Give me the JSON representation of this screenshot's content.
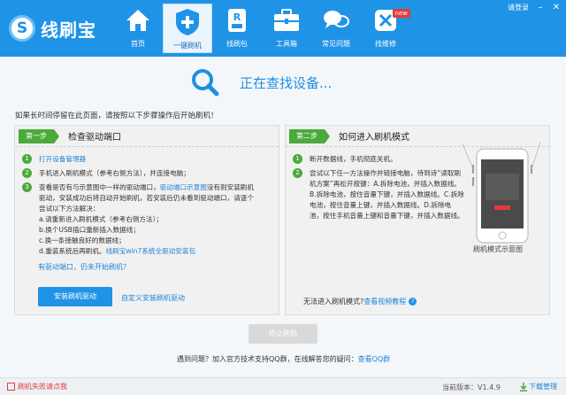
{
  "app": {
    "name": "线刷宝",
    "logo_glyph": "S"
  },
  "nav": [
    {
      "label": "首页",
      "icon": "home-icon"
    },
    {
      "label": "一键刷机",
      "icon": "shield-plus-icon",
      "active": true
    },
    {
      "label": "线刷包",
      "icon": "package-icon"
    },
    {
      "label": "工具箱",
      "icon": "toolbox-icon"
    },
    {
      "label": "常见问题",
      "icon": "chat-icon"
    },
    {
      "label": "找维修",
      "icon": "repair-icon",
      "badge": "new"
    }
  ],
  "topright": {
    "login": "请登录",
    "minimize": "–",
    "close": "✕"
  },
  "status": {
    "text": "正在查找设备..."
  },
  "hint": "如果长时间停留在此页面，请按照以下步骤操作后开始刷机！",
  "step1": {
    "tag": "第一步",
    "title": "检查驱动端口",
    "items": [
      {
        "num": "1",
        "text": "打开设备管理器"
      },
      {
        "num": "2",
        "text": "手机进入刷机模式（参考右侧方法），并连接电脑；"
      },
      {
        "num": "3",
        "text_a": "查看是否有与示意图中一样的驱动端口，",
        "link": "驱动端口示意图",
        "text_b": "没有则安装刷机驱动，安装成功后将自动开始刷机，若安装后仍未看到驱动端口，请逐个尝试以下方法解决："
      }
    ],
    "sub": [
      "a.请重新进入刷机模式（参考右侧方法）；",
      "b.换个USB插口重新插入数据线；",
      "c.换一条接触良好的数据线；"
    ],
    "sub_d_text": "d.重装系统后再刷机。",
    "sub_d_link": "线刷宝win7系统全驱动安装包",
    "no_port": "有驱动端口，仍未开始刷机？",
    "install_button": "安装刷机驱动",
    "custom_link": "自定义安装刷机驱动"
  },
  "step2": {
    "tag": "第二步",
    "title": "如何进入刷机模式",
    "items": [
      {
        "num": "1",
        "text": "断开数据线，手机彻底关机。"
      },
      {
        "num": "2",
        "text": "尝试以下任一方法操作并链接电脑，待到诗“读取刷机方案”再松开按键：A.拆除电池，并插入数据线。B.拆除电池，按住音量下键，并插入数据线。C.拆除电池，按住音量上键，并插入数据线。D.拆除电池，按住手机音量上键和音量下键，并插入数据线。"
      }
    ],
    "phone_caption": "刷机模式示意图",
    "no_flash_text": "无法进入刷机模式?",
    "no_flash_link": "查看视频教程"
  },
  "stop_button": "终止刷机",
  "footer": {
    "text_a": "遇到问题？加入官方技术支持QQ群，在线解答您的疑问：",
    "link": "查看QQ群"
  },
  "bottom": {
    "feedback": "刷机失败请点我",
    "version": "当前版本：V1.4.9",
    "download": "下载管理"
  },
  "colors": {
    "primary": "#1f93e6",
    "step_green": "#4aaa3a",
    "link": "#1f84d6",
    "alert_red": "#e03c3c"
  }
}
